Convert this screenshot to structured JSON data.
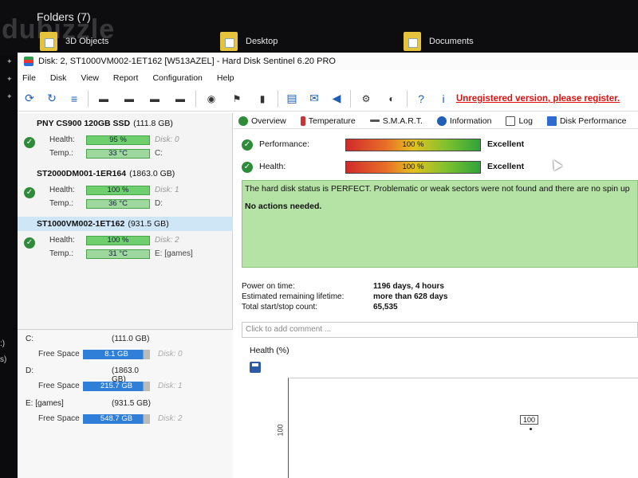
{
  "explorer": {
    "folders_title": "Folders (7)",
    "watermark": "dubizzle",
    "folders": [
      "3D Objects",
      "Desktop",
      "Documents"
    ],
    "left_parens": [
      ":)",
      "s)"
    ]
  },
  "app": {
    "title": "Disk: 2, ST1000VM002-1ET162 [W513AZEL]  -  Hard Disk Sentinel 6.20 PRO",
    "menu": [
      "File",
      "Disk",
      "View",
      "Report",
      "Configuration",
      "Help"
    ],
    "unregistered": "Unregistered version, please register."
  },
  "disks": [
    {
      "name": "PNY CS900 120GB SSD",
      "size": "(111.8 GB)",
      "health": "95 %",
      "health_extra": "Disk: 0",
      "temp": "33 °C",
      "temp_extra": "C:"
    },
    {
      "name": "ST2000DM001-1ER164",
      "size": "(1863.0 GB)",
      "health": "100 %",
      "health_extra": "Disk: 1",
      "temp": "36 °C",
      "temp_extra": "D:"
    },
    {
      "name": "ST1000VM002-1ET162",
      "size": "(931.5 GB)",
      "health": "100 %",
      "health_extra": "Disk: 2",
      "temp": "31 °C",
      "temp_extra": "E: [games]"
    }
  ],
  "labels": {
    "health": "Health:",
    "temp": "Temp.:",
    "free_space": "Free Space"
  },
  "volumes": [
    {
      "name": "C:",
      "size": "(111.0 GB)",
      "free": "8.1 GB",
      "disk": "Disk: 0"
    },
    {
      "name": "D:",
      "size": "(1863.0 GB)",
      "free": "215.7 GB",
      "disk": "Disk: 1"
    },
    {
      "name": "E: [games]",
      "size": "(931.5 GB)",
      "free": "548.7 GB",
      "disk": "Disk: 2"
    }
  ],
  "tabs": [
    "Overview",
    "Temperature",
    "S.M.A.R.T.",
    "Information",
    "Log",
    "Disk Performance"
  ],
  "overview": {
    "performance_label": "Performance:",
    "performance_value": "100 %",
    "performance_verdict": "Excellent",
    "health_label": "Health:",
    "health_value": "100 %",
    "health_verdict": "Excellent",
    "status_message": "The hard disk status is PERFECT. Problematic or weak sectors were not found and there are no spin up",
    "actions": "No actions needed.",
    "power_on_label": "Power on time:",
    "power_on_value": "1196 days, 4 hours",
    "lifetime_label": "Estimated remaining lifetime:",
    "lifetime_value": "more than 628 days",
    "startstop_label": "Total start/stop count:",
    "startstop_value": "65,535",
    "comment_placeholder": "Click to add comment ...",
    "graph_title": "Health (%)",
    "graph_ylabel": "100",
    "graph_point_label": "100"
  },
  "colors": {
    "accent_green": "#2e8b3a",
    "status_bg": "#b5e2a5",
    "unregistered": "#d11111"
  }
}
